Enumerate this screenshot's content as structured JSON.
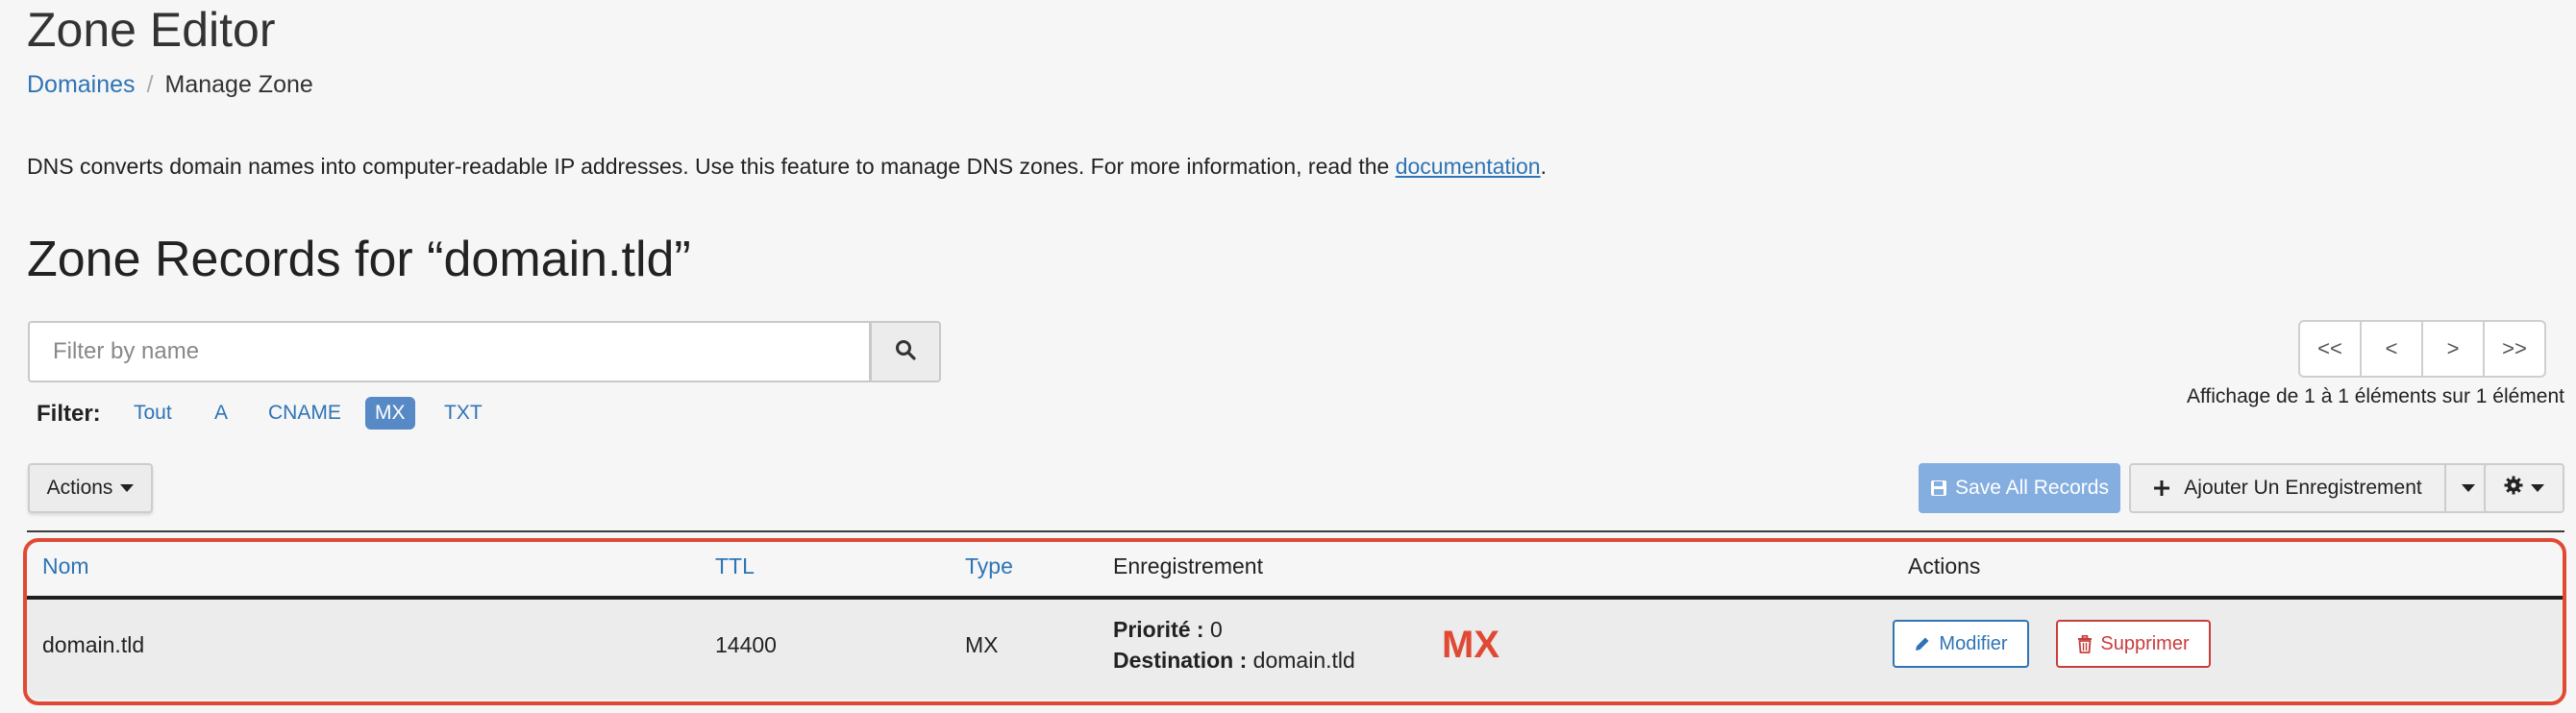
{
  "page": {
    "title": "Zone Editor",
    "breadcrumb": {
      "parent": "Domaines",
      "current": "Manage Zone"
    },
    "intro_text": "DNS converts domain names into computer-readable IP addresses. Use this feature to manage DNS zones. For more information, read the ",
    "intro_link": "documentation",
    "intro_end": ".",
    "section_title": "Zone Records for “domain.tld”"
  },
  "search": {
    "placeholder": "Filter by name",
    "value": ""
  },
  "filter": {
    "label": "Filter:",
    "options": [
      "Tout",
      "A",
      "CNAME",
      "MX",
      "TXT"
    ],
    "active": "MX"
  },
  "pagination": {
    "first": "<<",
    "prev": "<",
    "next": ">",
    "last": ">>",
    "info": "Affichage de 1 à 1 éléments sur 1 élément"
  },
  "toolbar": {
    "actions_label": "Actions",
    "save_label": "Save All Records",
    "add_label": "Ajouter Un Enregistrement"
  },
  "table": {
    "headers": {
      "name": "Nom",
      "ttl": "TTL",
      "type": "Type",
      "record": "Enregistrement",
      "actions": "Actions"
    },
    "rows": [
      {
        "name": "domain.tld",
        "ttl": "14400",
        "type": "MX",
        "priority_label": "Priorité :",
        "priority_value": "0",
        "destination_label": "Destination :",
        "destination_value": "domain.tld",
        "badge": "MX",
        "edit_label": "Modifier",
        "delete_label": "Supprimer"
      }
    ]
  },
  "colors": {
    "link": "#2e74b5",
    "active_filter": "#5789c6",
    "save_button": "#84aedf",
    "highlight": "#e04a35",
    "delete": "#c93c3c"
  },
  "icons": [
    "search-icon",
    "caret-down-icon",
    "save-icon",
    "plus-icon",
    "gear-icon",
    "pencil-icon",
    "trash-icon"
  ]
}
